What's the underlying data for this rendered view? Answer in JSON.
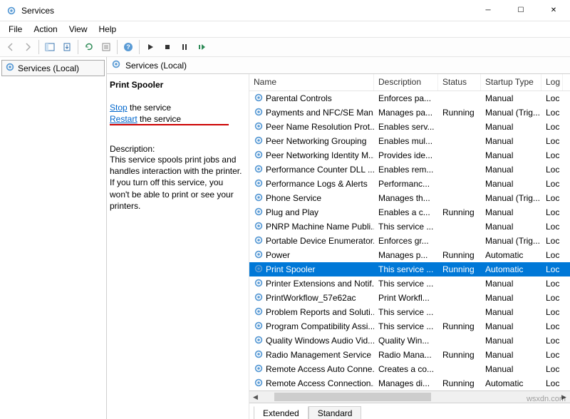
{
  "window": {
    "title": "Services"
  },
  "menu": {
    "file": "File",
    "action": "Action",
    "view": "View",
    "help": "Help"
  },
  "tree": {
    "root": "Services (Local)"
  },
  "pane": {
    "header": "Services (Local)"
  },
  "detail": {
    "service_name": "Print Spooler",
    "stop_label": "Stop",
    "stop_suffix": " the service",
    "restart_label": "Restart",
    "restart_suffix": " the service",
    "description_label": "Description:",
    "description_text": "This service spools print jobs and handles interaction with the printer. If you turn off this service, you won't be able to print or see your printers."
  },
  "columns": {
    "name": "Name",
    "description": "Description",
    "status": "Status",
    "startup": "Startup Type",
    "logon": "Log"
  },
  "services": [
    {
      "name": "Parental Controls",
      "desc": "Enforces pa...",
      "status": "",
      "startup": "Manual",
      "log": "Loc"
    },
    {
      "name": "Payments and NFC/SE Man...",
      "desc": "Manages pa...",
      "status": "Running",
      "startup": "Manual (Trig...",
      "log": "Loc"
    },
    {
      "name": "Peer Name Resolution Prot...",
      "desc": "Enables serv...",
      "status": "",
      "startup": "Manual",
      "log": "Loc"
    },
    {
      "name": "Peer Networking Grouping",
      "desc": "Enables mul...",
      "status": "",
      "startup": "Manual",
      "log": "Loc"
    },
    {
      "name": "Peer Networking Identity M...",
      "desc": "Provides ide...",
      "status": "",
      "startup": "Manual",
      "log": "Loc"
    },
    {
      "name": "Performance Counter DLL ...",
      "desc": "Enables rem...",
      "status": "",
      "startup": "Manual",
      "log": "Loc"
    },
    {
      "name": "Performance Logs & Alerts",
      "desc": "Performanc...",
      "status": "",
      "startup": "Manual",
      "log": "Loc"
    },
    {
      "name": "Phone Service",
      "desc": "Manages th...",
      "status": "",
      "startup": "Manual (Trig...",
      "log": "Loc"
    },
    {
      "name": "Plug and Play",
      "desc": "Enables a c...",
      "status": "Running",
      "startup": "Manual",
      "log": "Loc"
    },
    {
      "name": "PNRP Machine Name Publi...",
      "desc": "This service ...",
      "status": "",
      "startup": "Manual",
      "log": "Loc"
    },
    {
      "name": "Portable Device Enumerator...",
      "desc": "Enforces gr...",
      "status": "",
      "startup": "Manual (Trig...",
      "log": "Loc"
    },
    {
      "name": "Power",
      "desc": "Manages p...",
      "status": "Running",
      "startup": "Automatic",
      "log": "Loc"
    },
    {
      "name": "Print Spooler",
      "desc": "This service ...",
      "status": "Running",
      "startup": "Automatic",
      "log": "Loc",
      "selected": true
    },
    {
      "name": "Printer Extensions and Notif...",
      "desc": "This service ...",
      "status": "",
      "startup": "Manual",
      "log": "Loc"
    },
    {
      "name": "PrintWorkflow_57e62ac",
      "desc": "Print Workfl...",
      "status": "",
      "startup": "Manual",
      "log": "Loc"
    },
    {
      "name": "Problem Reports and Soluti...",
      "desc": "This service ...",
      "status": "",
      "startup": "Manual",
      "log": "Loc"
    },
    {
      "name": "Program Compatibility Assi...",
      "desc": "This service ...",
      "status": "Running",
      "startup": "Manual",
      "log": "Loc"
    },
    {
      "name": "Quality Windows Audio Vid...",
      "desc": "Quality Win...",
      "status": "",
      "startup": "Manual",
      "log": "Loc"
    },
    {
      "name": "Radio Management Service",
      "desc": "Radio Mana...",
      "status": "Running",
      "startup": "Manual",
      "log": "Loc"
    },
    {
      "name": "Remote Access Auto Conne...",
      "desc": "Creates a co...",
      "status": "",
      "startup": "Manual",
      "log": "Loc"
    },
    {
      "name": "Remote Access Connection...",
      "desc": "Manages di...",
      "status": "Running",
      "startup": "Automatic",
      "log": "Loc"
    }
  ],
  "tabs": {
    "extended": "Extended",
    "standard": "Standard"
  },
  "watermark": "wsxdn.com"
}
